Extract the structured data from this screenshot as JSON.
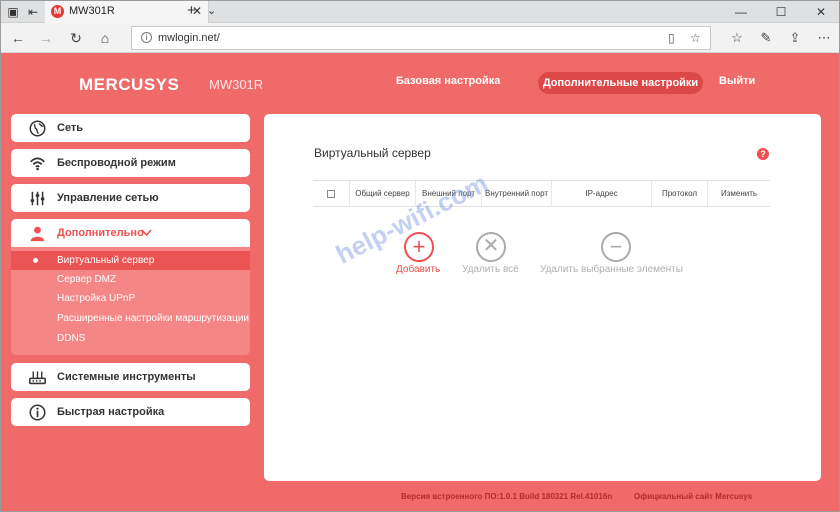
{
  "browser": {
    "tab_title": "MW301R",
    "tab_favicon": "M",
    "url": "mwlogin.net/"
  },
  "header": {
    "brand": "MERCUSYS",
    "model": "MW301R",
    "nav_basic": "Базовая настройка",
    "nav_advanced": "Дополнительные настройки",
    "nav_logout": "Выйти"
  },
  "sidebar": {
    "items": [
      {
        "label": "Сеть",
        "icon": "globe-icon"
      },
      {
        "label": "Беспроводной режим",
        "icon": "wifi-icon"
      },
      {
        "label": "Управление сетью",
        "icon": "sliders-icon"
      },
      {
        "label": "Дополнительно",
        "icon": "user-icon"
      },
      {
        "label": "Системные инструменты",
        "icon": "router-icon"
      },
      {
        "label": "Быстрая настройка",
        "icon": "info-icon"
      }
    ],
    "subitems": [
      {
        "label": "Виртуальный сервер"
      },
      {
        "label": "Сервер DMZ"
      },
      {
        "label": "Настройка UPnP"
      },
      {
        "label": "Расширенные настройки маршрутизации"
      },
      {
        "label": "DDNS"
      }
    ]
  },
  "main": {
    "title": "Виртуальный сервер",
    "help": "?",
    "columns": [
      "Общий сервер",
      "Внешний порт",
      "Внутренний порт",
      "IP-адрес",
      "Протокол",
      "Изменить"
    ],
    "actions": {
      "add": "Добавить",
      "delete_all": "Удалить всё",
      "delete_selected": "Удалить выбранные элементы"
    }
  },
  "watermark": "help-wifi.com",
  "footer": {
    "firmware": "Версия встроенного ПО:1.0.1 Build 180321 Rel.41016n",
    "site": "Официальный сайт Mercusys"
  },
  "colors": {
    "accent": "#f06a6a",
    "accent_dark": "#dc4848",
    "submenu": "#f58686"
  }
}
